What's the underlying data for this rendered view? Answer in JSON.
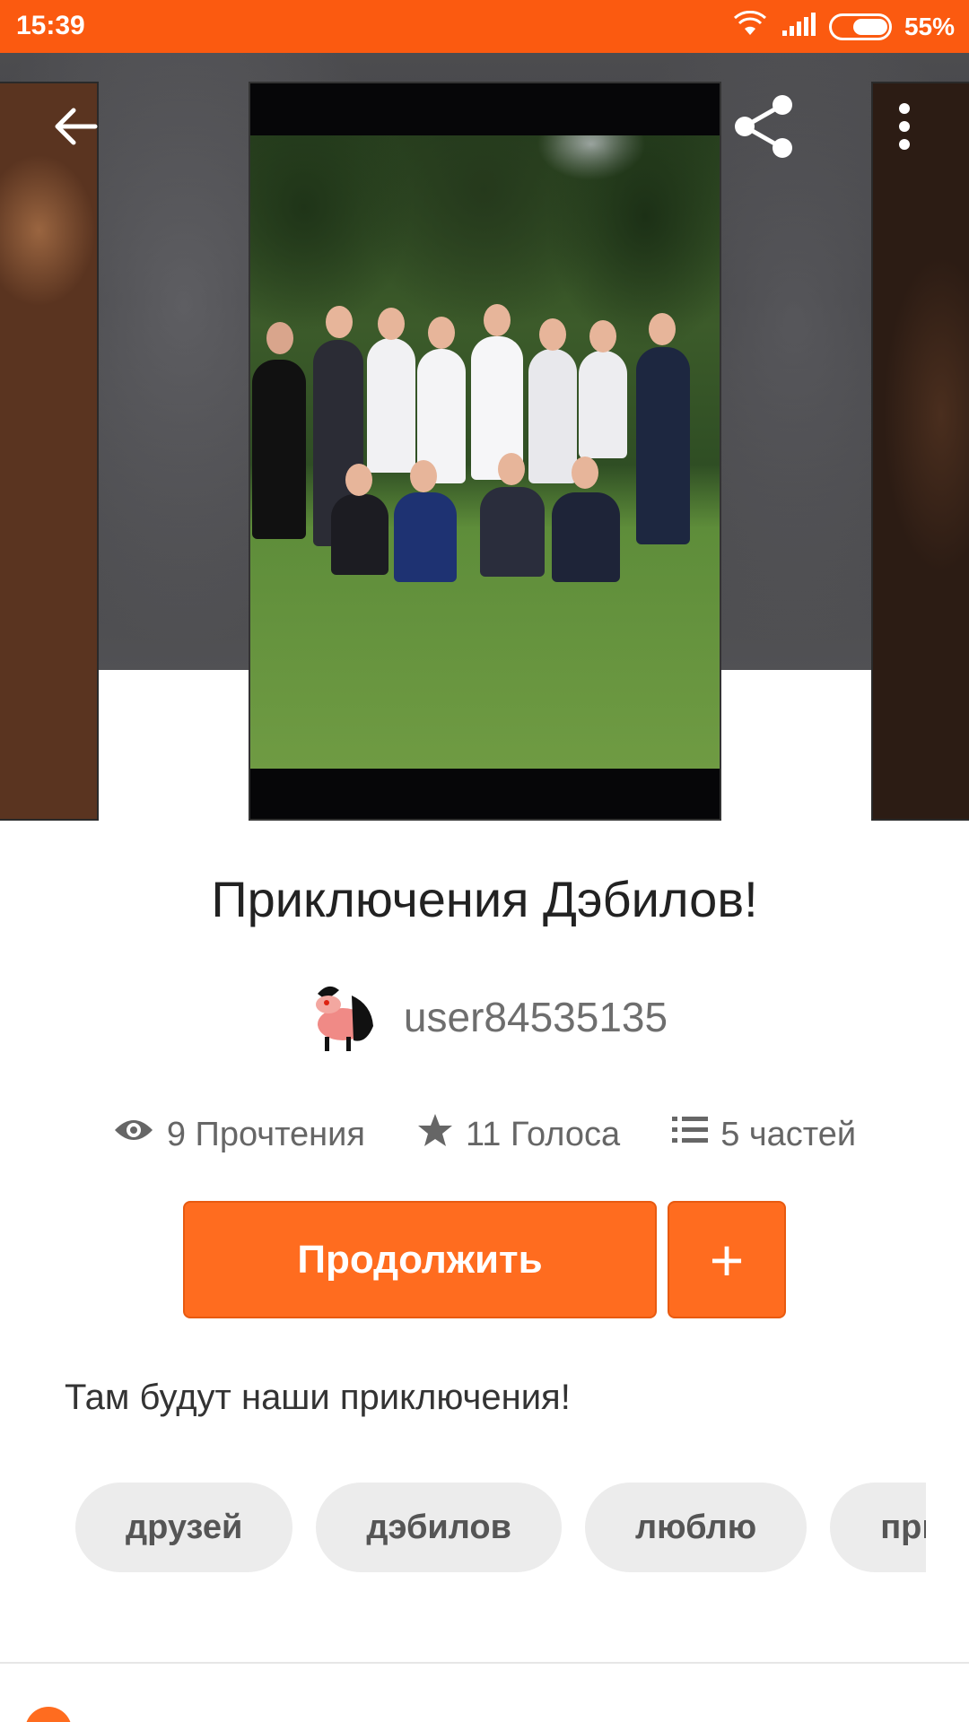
{
  "status_bar": {
    "time": "15:39",
    "battery_percent": "55%",
    "icons": [
      "wifi-icon",
      "signal-icon",
      "battery-icon"
    ]
  },
  "toolbar": {
    "icons": [
      "back-arrow-icon",
      "share-icon",
      "more-vertical-icon"
    ]
  },
  "story": {
    "title": "Приключения Дэбилов!",
    "author": "user84535135",
    "reads": "9 Прочтения",
    "votes": "11 Голоса",
    "parts": "5 частей",
    "description": "Там будут наши приключения!"
  },
  "actions": {
    "continue_label": "Продолжить",
    "add_label": "+"
  },
  "tags": [
    "друзей",
    "дэбилов",
    "люблю",
    "приключения"
  ],
  "colors": {
    "accent": "#ff6c1f",
    "status_bar": "#fb5a10",
    "tag_bg": "#ececec"
  }
}
